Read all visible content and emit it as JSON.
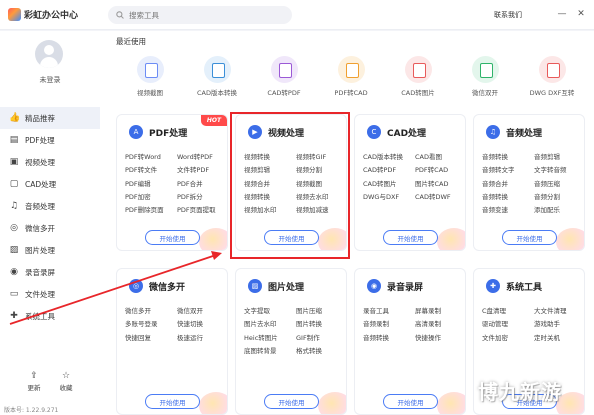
{
  "app": {
    "title": "彩虹办公中心"
  },
  "search": {
    "placeholder": "搜索工具"
  },
  "header": {
    "contact": "联系我们",
    "minimize": "—",
    "close": "✕"
  },
  "user": {
    "status": "未登录"
  },
  "sidebar": {
    "items": [
      {
        "label": "精品推荐",
        "icon": "thumbs-up-icon",
        "glyph": "👍"
      },
      {
        "label": "PDF处理",
        "icon": "pdf-icon",
        "glyph": "▤"
      },
      {
        "label": "视频处理",
        "icon": "video-icon",
        "glyph": "▣"
      },
      {
        "label": "CAD处理",
        "icon": "cad-icon",
        "glyph": "▢"
      },
      {
        "label": "音频处理",
        "icon": "music-note-icon",
        "glyph": "♫"
      },
      {
        "label": "微信多开",
        "icon": "wechat-icon",
        "glyph": "◎"
      },
      {
        "label": "图片处理",
        "icon": "image-icon",
        "glyph": "▨"
      },
      {
        "label": "录音录屏",
        "icon": "record-icon",
        "glyph": "◉"
      },
      {
        "label": "文件处理",
        "icon": "folder-icon",
        "glyph": "▭"
      },
      {
        "label": "系统工具",
        "icon": "tools-icon",
        "glyph": "✚"
      }
    ],
    "footer": {
      "update": "更新",
      "favorite": "收藏"
    },
    "version": "版本号: 1.22.9.271"
  },
  "main": {
    "recent_title": "最近使用",
    "recent": [
      {
        "label": "视频截图",
        "color": "#6c8cf5",
        "bg": "#e8eefc"
      },
      {
        "label": "CAD版本转换",
        "color": "#3b8fd8",
        "bg": "#e4f0fb"
      },
      {
        "label": "CAD转PDF",
        "color": "#9b59d6",
        "bg": "#f0e7fa"
      },
      {
        "label": "PDF转CAD",
        "color": "#f0a030",
        "bg": "#fdf1de"
      },
      {
        "label": "CAD转图片",
        "color": "#e85a5a",
        "bg": "#fce7e7"
      },
      {
        "label": "微信双开",
        "color": "#2fb36a",
        "bg": "#e3f6ec"
      },
      {
        "label": "DWG DXF互转",
        "color": "#e85a5a",
        "bg": "#fce7e7"
      }
    ],
    "button_label": "开始使用",
    "hot_badge": "HOT",
    "cards": [
      {
        "title": "PDF处理",
        "color": "#3c6de8",
        "glyph": "A",
        "items": [
          "PDF转Word",
          "Word转PDF",
          "PDF转文件",
          "文件转PDF",
          "PDF编辑",
          "PDF合并",
          "PDF加密",
          "PDF拆分",
          "PDF删除页面",
          "PDF页面提取"
        ]
      },
      {
        "title": "视频处理",
        "color": "#3c6de8",
        "glyph": "▶",
        "items": [
          "视频转换",
          "视频转GIF",
          "视频剪辑",
          "视频分割",
          "视频合并",
          "视频截图",
          "视频转换",
          "视频去水印",
          "视频加水印",
          "视频加减速"
        ]
      },
      {
        "title": "CAD处理",
        "color": "#3c6de8",
        "glyph": "C",
        "items": [
          "CAD版本转换",
          "CAD看图",
          "CAD转PDF",
          "PDF转CAD",
          "CAD转图片",
          "图片转CAD",
          "DWG与DXF",
          "CAD转DWF"
        ]
      },
      {
        "title": "音频处理",
        "color": "#3c6de8",
        "glyph": "♫",
        "items": [
          "音频转换",
          "音频剪辑",
          "音频转文字",
          "文字转音频",
          "音频合并",
          "音频压缩",
          "音频转换",
          "音频分割",
          "音频变速",
          "添加配乐"
        ]
      },
      {
        "title": "微信多开",
        "color": "#3c6de8",
        "glyph": "◎",
        "items": [
          "微信多开",
          "微信双开",
          "多账号登录",
          "快速切换",
          "快捷回复",
          "极速运行"
        ]
      },
      {
        "title": "图片处理",
        "color": "#3c6de8",
        "glyph": "▨",
        "items": [
          "文字提取",
          "图片压缩",
          "图片去水印",
          "图片转换",
          "Heic转图片",
          "GIF制作",
          "底图转背景",
          "格式转换"
        ]
      },
      {
        "title": "录音录屏",
        "color": "#3c6de8",
        "glyph": "◉",
        "items": [
          "录音工具",
          "屏幕录制",
          "音频录制",
          "高清录制",
          "音频转换",
          "快捷操作"
        ]
      },
      {
        "title": "系统工具",
        "color": "#3c6de8",
        "glyph": "✚",
        "items": [
          "C盘清理",
          "大文件清理",
          "驱动管理",
          "游戏助手",
          "文件加密",
          "定时关机"
        ]
      }
    ]
  },
  "watermark": "博九新游"
}
